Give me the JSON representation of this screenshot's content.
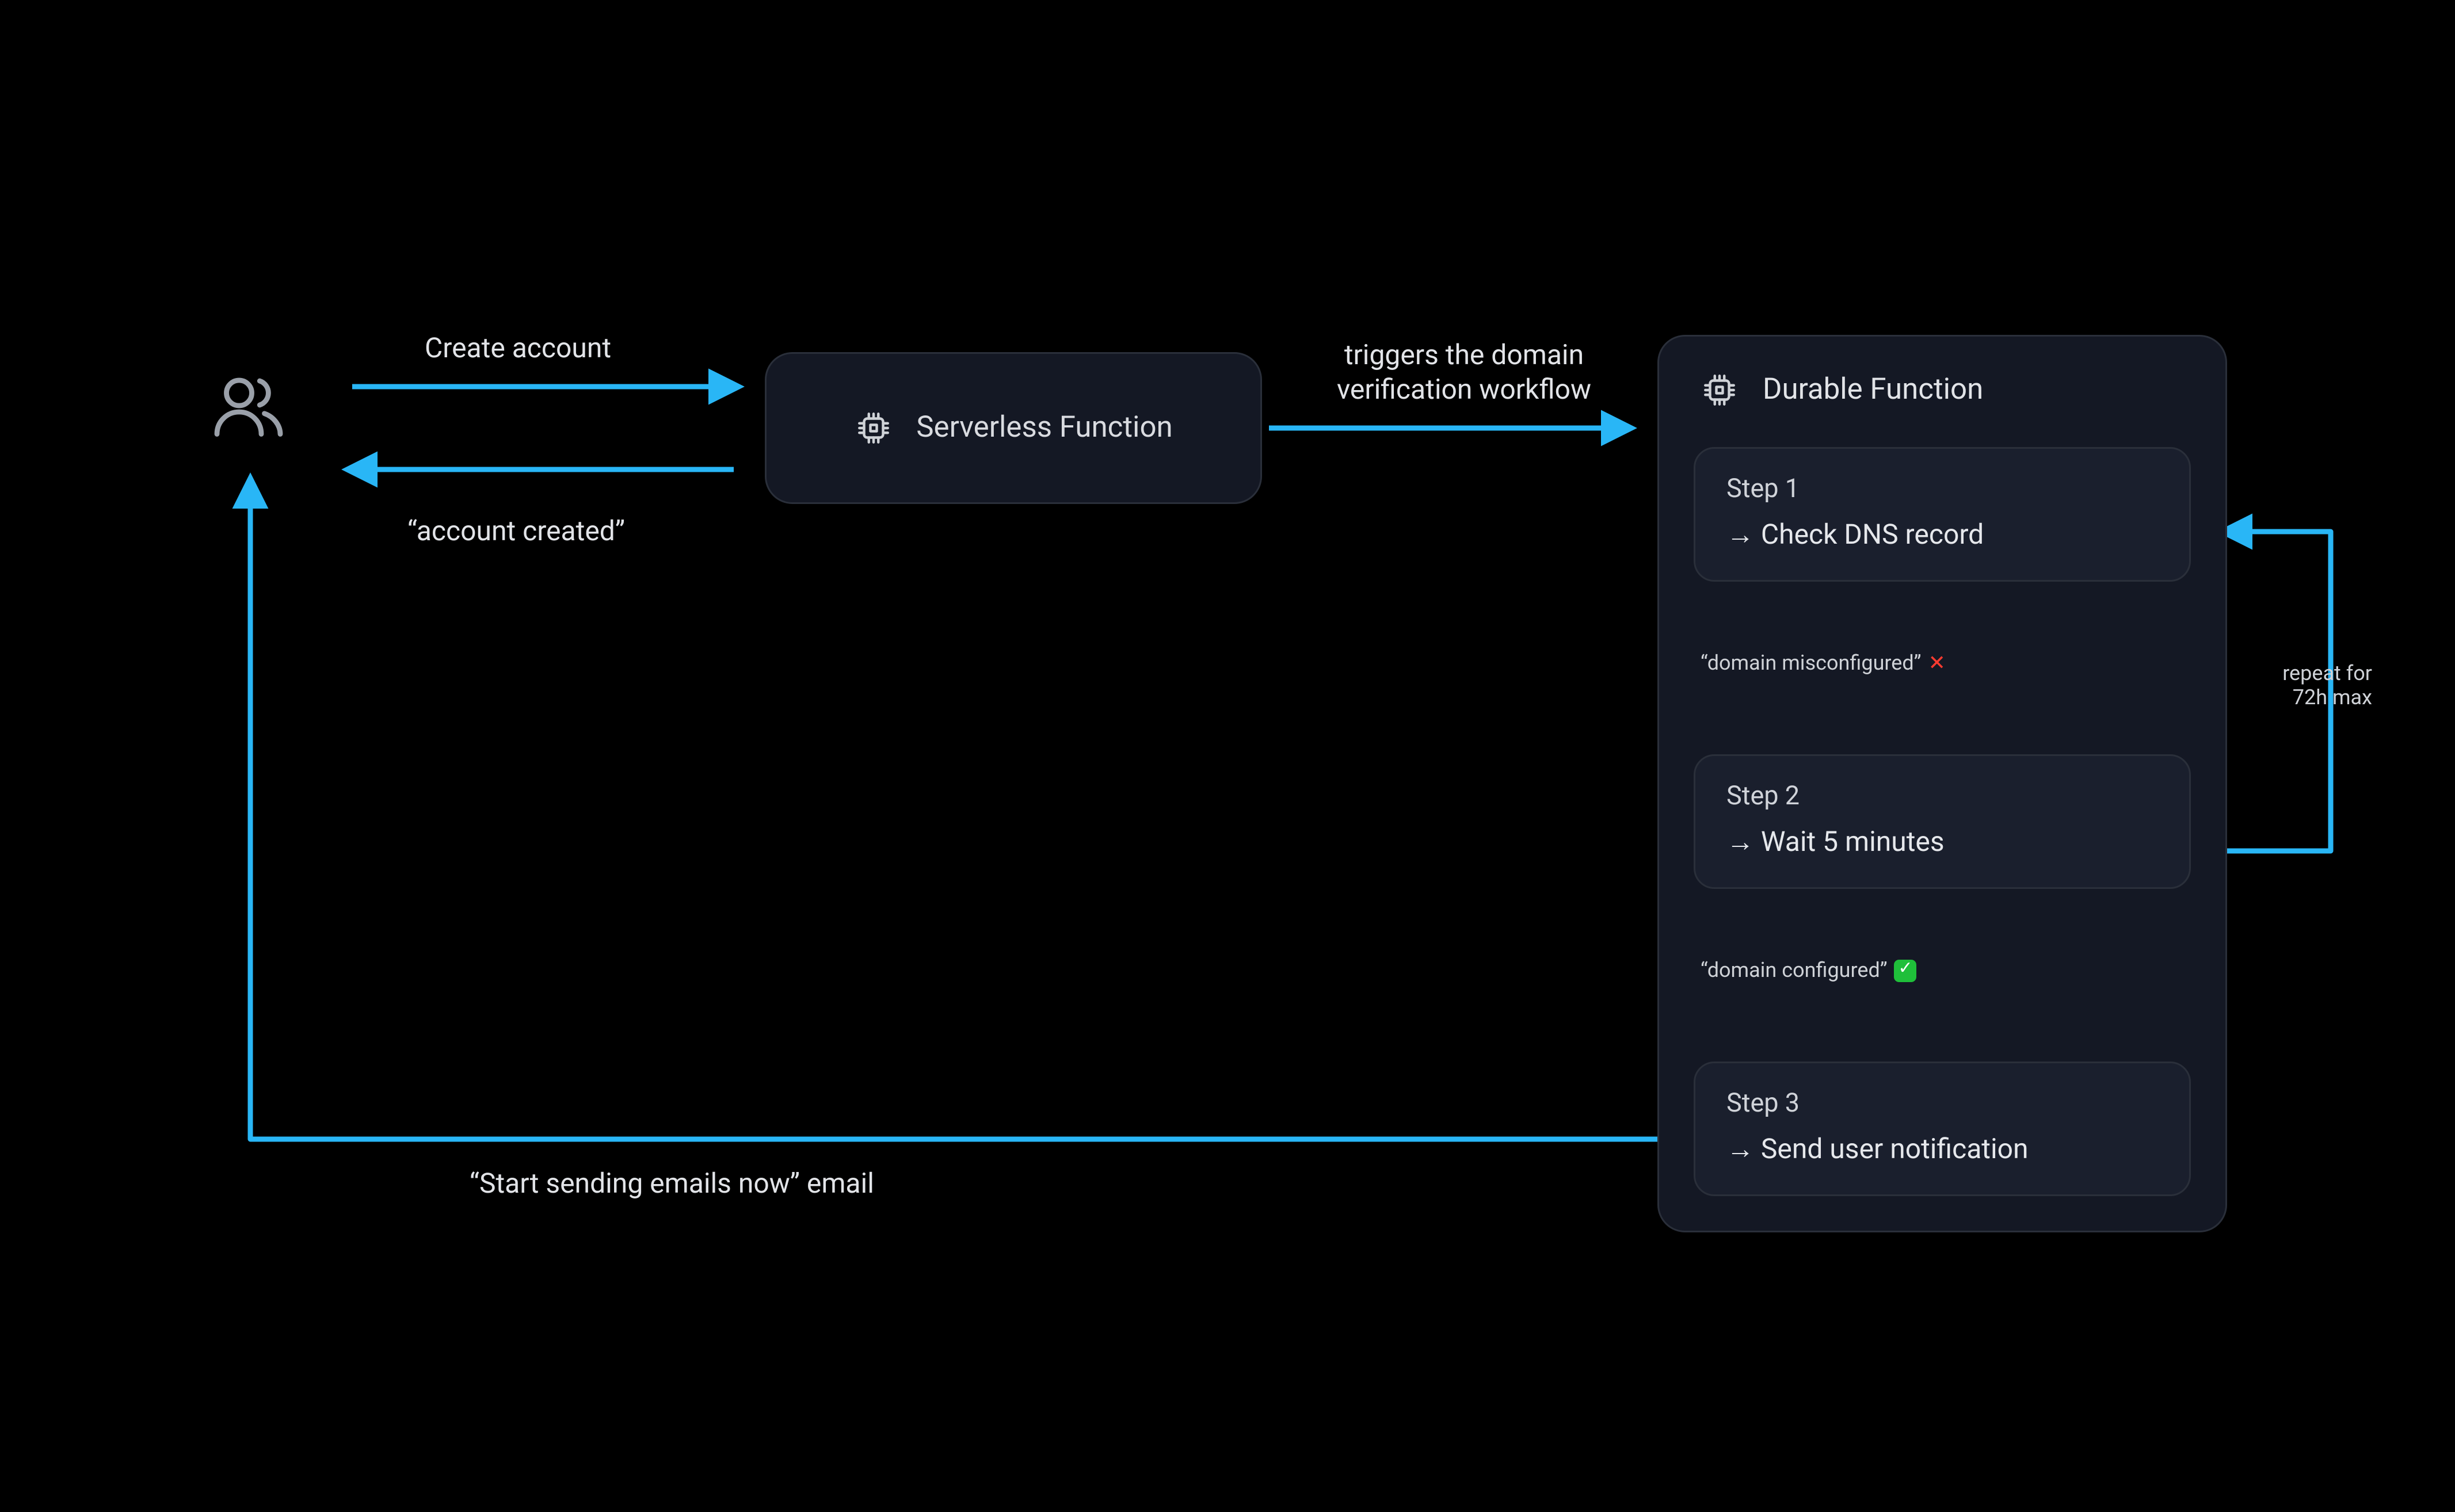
{
  "labels": {
    "create_account": "Create account",
    "account_created": "“account created”",
    "triggers": "triggers the domain\nverification workflow",
    "final_email": "“Start sending emails now” email",
    "repeat": "repeat for\n72h max",
    "domain_misconfigured": "“domain misconfigured”",
    "domain_configured": "“domain configured”"
  },
  "nodes": {
    "serverless": "Serverless Function",
    "durable": "Durable Function"
  },
  "steps": {
    "s1": {
      "name": "Step 1",
      "action": "→ Check DNS record"
    },
    "s2": {
      "name": "Step 2",
      "action": "→ Wait 5 minutes"
    },
    "s3": {
      "name": "Step 3",
      "action": "→ Send user notification"
    }
  },
  "icons": {
    "user": "user-icon",
    "chip": "chip-icon"
  }
}
